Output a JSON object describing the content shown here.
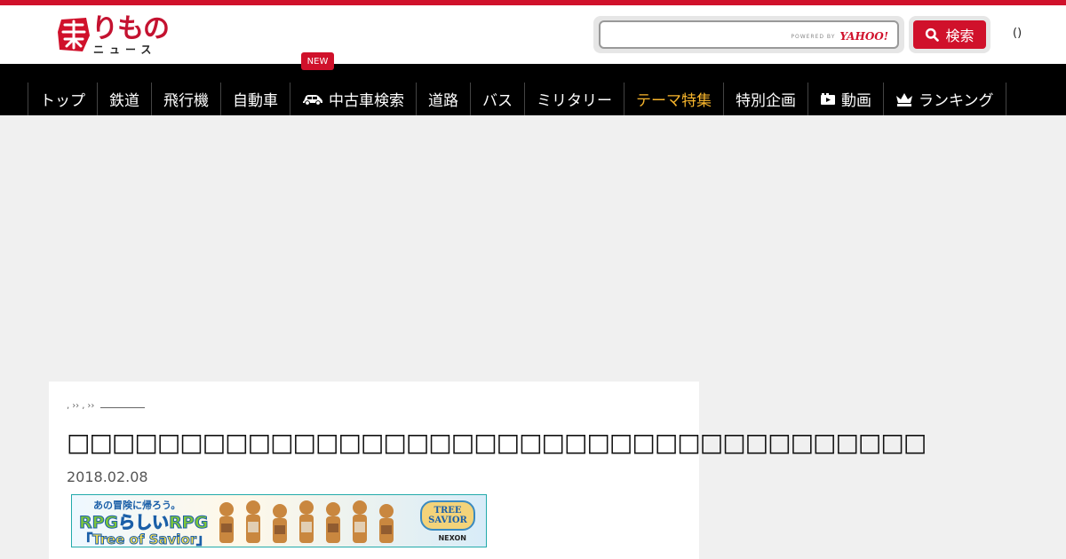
{
  "brand": {
    "logo_main": "りもの",
    "logo_sub": "ニュース",
    "accent_color": "#d0112b"
  },
  "search": {
    "placeholder": "",
    "powered_by": "POWERED BY",
    "provider": "YAHOO!",
    "button_label": "検索"
  },
  "header": {
    "misc": "()"
  },
  "nav": {
    "new_badge": "NEW",
    "items": [
      {
        "label": "トップ"
      },
      {
        "label": "鉄道"
      },
      {
        "label": "飛行機"
      },
      {
        "label": "自動車"
      },
      {
        "label": "中古車検索",
        "icon": "car-icon"
      },
      {
        "label": "道路"
      },
      {
        "label": "バス"
      },
      {
        "label": "ミリタリー"
      },
      {
        "label": "テーマ特集",
        "accent": "#f7b52c"
      },
      {
        "label": "特別企画"
      },
      {
        "label": "動画",
        "icon": "video-icon"
      },
      {
        "label": "ランキング",
        "icon": "crown-icon"
      }
    ]
  },
  "article": {
    "breadcrumb": [
      ",",
      "››",
      ",",
      "››"
    ],
    "title": "□□□□□□□□□□□□□□□□□□□□□□□□□□□□□□□□□□□□□□",
    "date": "2018.02.08"
  },
  "ad_banner": {
    "line1": "あの冒険に帰ろう。",
    "line2": "RPGらしいRPG",
    "line3": "「Tree of Savior」",
    "logo": "TREE SAVIOR",
    "publisher": "NEXON"
  }
}
